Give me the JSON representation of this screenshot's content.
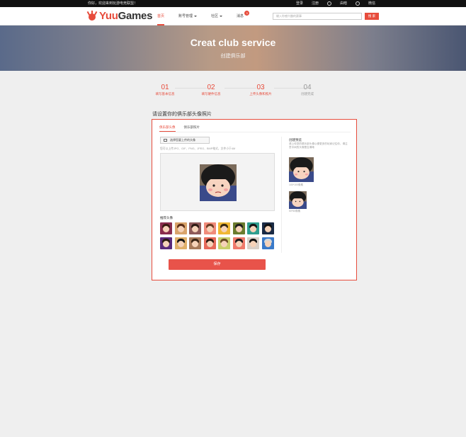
{
  "topbar": {
    "greeting": "你好，欢迎来到玩游电竞联盟！",
    "links": [
      "登录",
      "注册",
      "",
      "由暗",
      "",
      "微信"
    ]
  },
  "nav": {
    "logo_yuu": "Yuu",
    "logo_games": "Games",
    "menu": [
      {
        "label": "首页",
        "active": true,
        "caret": false,
        "badge": ""
      },
      {
        "label": "账号管理",
        "active": false,
        "caret": true,
        "badge": ""
      },
      {
        "label": "社区",
        "active": false,
        "caret": true,
        "badge": ""
      },
      {
        "label": "消息",
        "active": false,
        "caret": false,
        "badge": "3"
      }
    ],
    "search_placeholder": "输入你感兴趣的赛事",
    "search_button": "搜 索"
  },
  "banner": {
    "title": "Creat club service",
    "subtitle": "创建俱乐部"
  },
  "steps": [
    {
      "num": "01",
      "label": "填写基本信息",
      "done": false
    },
    {
      "num": "02",
      "label": "填写硬件信息",
      "done": false
    },
    {
      "num": "03",
      "label": "上传头像和照片",
      "done": false
    },
    {
      "num": "04",
      "label": "创建完成",
      "done": true
    }
  ],
  "section_title": "请设置你的俱乐部头像照片",
  "panel": {
    "tabs": [
      "俱乐部头像",
      "俱乐部头像"
    ],
    "tab_labels": [
      "俱乐部头像",
      "俱乐部照片"
    ],
    "upload_button": "选择您要上传的头像",
    "hint": "您可以上传JPG、GIF、PNG、JPEG、BMP格式，文件小于4M",
    "recommended_title": "推荐头像",
    "side_title": "创建预览",
    "side_desc": "请上传您的俱乐部头像以便更多的玩家记住你，请注意中间的头像是否清晰",
    "preview_100_label": "100*100像素",
    "preview_50_label": "50*50像素",
    "save_button": "保存"
  },
  "colors": {
    "accent": "#e74c3c",
    "save": "#e8534a"
  },
  "thumb_colors": [
    [
      "#8a2d4e",
      "#3b1a12"
    ],
    [
      "#d9a46b",
      "#5a2e16"
    ],
    [
      "#8e5a5a",
      "#2d1a14"
    ],
    [
      "#f08b7a",
      "#6a3a22"
    ],
    [
      "#f0b834",
      "#3a2a10"
    ],
    [
      "#6b7b2d",
      "#1e1e1e"
    ],
    [
      "#2f9e8f",
      "#141414"
    ],
    [
      "#1a2a44",
      "#111111"
    ],
    [
      "#5a2a7a",
      "#2a1a10"
    ],
    [
      "#e0b06a",
      "#111111"
    ],
    [
      "#a87a5a",
      "#3a2414"
    ],
    [
      "#e66a5a",
      "#2a1a10"
    ],
    [
      "#c9cf6b",
      "#6a4a24"
    ],
    [
      "#ef7a6b",
      "#1a1a1a"
    ],
    [
      "#d9d0c8",
      "#111111"
    ],
    [
      "#3a7ac9",
      "#d6d6d6"
    ]
  ]
}
